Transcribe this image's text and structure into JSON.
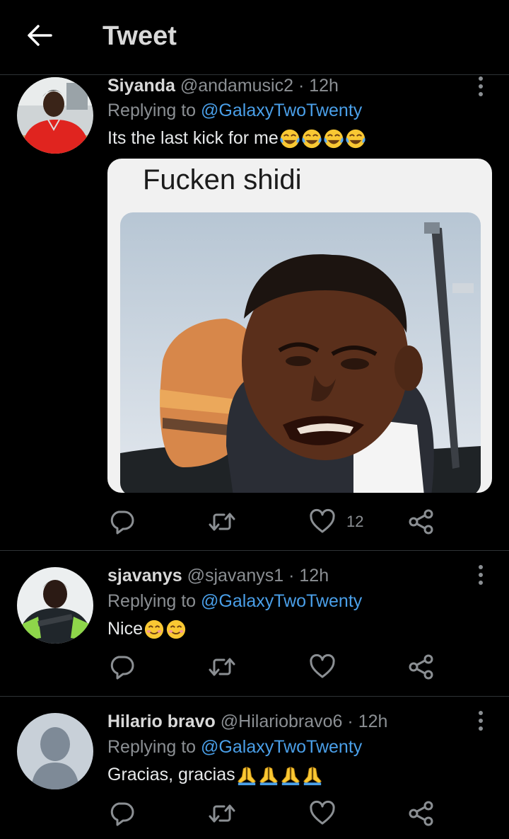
{
  "header": {
    "title": "Tweet",
    "back_icon": "arrow-left-icon"
  },
  "tweets": [
    {
      "name": "Siyanda",
      "handle": "@andamusic2",
      "separator": "·",
      "time": "12h",
      "reply_prefix": "Replying to",
      "reply_to": "@GalaxyTwoTwenty",
      "text": "Its the last kick for me",
      "emojis": [
        "😂",
        "😂",
        "😂",
        "😂"
      ],
      "media": {
        "caption": "Fucken shidi"
      },
      "like_count": "12"
    },
    {
      "name": "sjavanys",
      "handle": "@sjavanys1",
      "separator": "·",
      "time": "12h",
      "reply_prefix": "Replying to",
      "reply_to": "@GalaxyTwoTwenty",
      "text": "Nice",
      "emojis": [
        "😊",
        "😊"
      ]
    },
    {
      "name": "Hilario bravo",
      "handle": "@Hilariobravo6",
      "separator": "·",
      "time": "12h",
      "reply_prefix": "Replying to",
      "reply_to": "@GalaxyTwoTwenty",
      "text": "Gracias, gracias",
      "emojis": [
        "🙏",
        "🙏",
        "🙏",
        "🙏"
      ]
    }
  ],
  "colors": {
    "background": "#000000",
    "accent": "#4a9fe8",
    "muted": "#8b8f93",
    "divider": "#2f3336"
  }
}
